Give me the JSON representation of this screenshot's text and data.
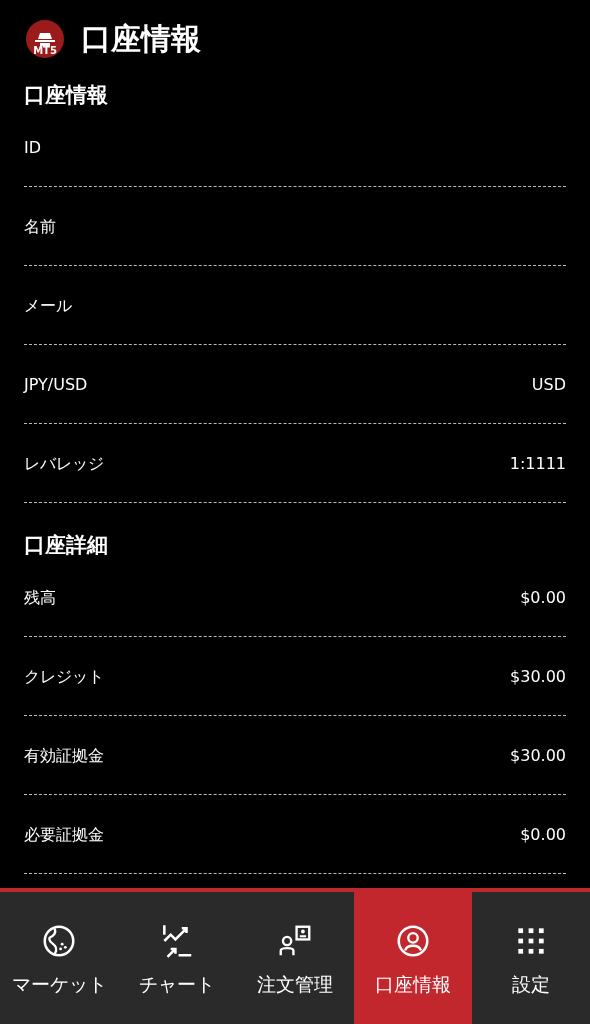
{
  "header": {
    "logo_text": "MT5",
    "title": "口座情報"
  },
  "sections": [
    {
      "title": "口座情報",
      "rows": [
        {
          "label": "ID"
        },
        {
          "label": "名前"
        },
        {
          "label": "メール"
        },
        {
          "label": "JPY/USD",
          "value": "USD"
        },
        {
          "label": "レバレッジ",
          "value": "1:1111"
        }
      ]
    },
    {
      "title": "口座詳細",
      "rows": [
        {
          "label": "残高",
          "value": "$0.00"
        },
        {
          "label": "クレジット",
          "value": "$30.00"
        },
        {
          "label": "有効証拠金",
          "value": "$30.00"
        },
        {
          "label": "必要証拠金",
          "value": "$0.00"
        }
      ]
    }
  ],
  "tab_bar": [
    {
      "kind": "globe",
      "label": "マーケット",
      "selected": false
    },
    {
      "kind": "chart",
      "label": "チャート",
      "selected": false
    },
    {
      "kind": "orders",
      "label": "注文管理",
      "selected": false
    },
    {
      "kind": "account",
      "label": "口座情報",
      "selected": true
    },
    {
      "kind": "grid",
      "label": "設定",
      "selected": false
    }
  ]
}
